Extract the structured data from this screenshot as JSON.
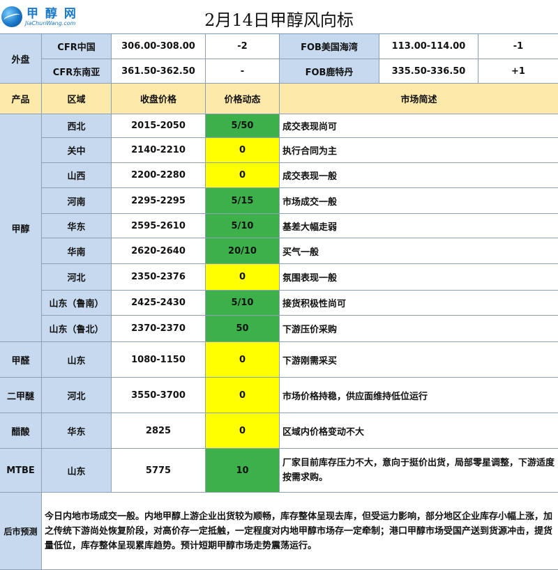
{
  "logo": {
    "cn": "甲 醇 网",
    "en": "JiaChunWang.com"
  },
  "title": "2月14日甲醇风向标",
  "external": {
    "label": "外盘",
    "rows": [
      {
        "name1": "CFR中国",
        "price1": "306.00-308.00",
        "chg1": "-2",
        "name2": "FOB美国海湾",
        "price2": "113.00-114.00",
        "chg2": "-1"
      },
      {
        "name1": "CFR东南亚",
        "price1": "361.50-362.50",
        "chg1": "-",
        "name2": "FOB鹿特丹",
        "price2": "335.50-336.50",
        "chg2": "+1"
      }
    ]
  },
  "headers": {
    "product": "产品",
    "region": "区域",
    "price": "收盘价格",
    "change": "价格动态",
    "desc": "市场简述"
  },
  "methanol": {
    "label": "甲醇",
    "rows": [
      {
        "region": "西北",
        "price": "2015-2050",
        "change": "5/50",
        "desc": "成交表现尚可",
        "color": "#3cb14a"
      },
      {
        "region": "关中",
        "price": "2140-2210",
        "change": "0",
        "desc": "执行合同为主",
        "color": "#ffff00"
      },
      {
        "region": "山西",
        "price": "2200-2280",
        "change": "0",
        "desc": "成交表现一般",
        "color": "#ffff00"
      },
      {
        "region": "河南",
        "price": "2295-2295",
        "change": "5/15",
        "desc": "市场成交一般",
        "color": "#3cb14a"
      },
      {
        "region": "华东",
        "price": "2595-2610",
        "change": "5/10",
        "desc": "基差大幅走弱",
        "color": "#3cb14a"
      },
      {
        "region": "华南",
        "price": "2620-2640",
        "change": "20/10",
        "desc": "买气一般",
        "color": "#3cb14a"
      },
      {
        "region": "河北",
        "price": "2350-2376",
        "change": "0",
        "desc": "氛围表现一般",
        "color": "#ffff00"
      },
      {
        "region": "山东（鲁南）",
        "price": "2425-2430",
        "change": "5/10",
        "desc": "接货积极性尚可",
        "color": "#3cb14a"
      },
      {
        "region": "山东（鲁北）",
        "price": "2370-2370",
        "change": "50",
        "desc": "下游压价采购",
        "color": "#3cb14a"
      }
    ]
  },
  "others": [
    {
      "product": "甲醛",
      "region": "山东",
      "price": "1080-1150",
      "change": "0",
      "desc": "下游刚需采买",
      "color": "#ffff00"
    },
    {
      "product": "二甲醚",
      "region": "河北",
      "price": "3550-3700",
      "change": "0",
      "desc": "市场价格持稳，供应面维持低位运行",
      "color": "#ffff00"
    },
    {
      "product": "醋酸",
      "region": "华东",
      "price": "2825",
      "change": "0",
      "desc": "区域内价格变动不大",
      "color": "#ffff00"
    },
    {
      "product": "MTBE",
      "region": "山东",
      "price": "5775",
      "change": "10",
      "desc": "厂家目前库存压力不大，意向于挺价出货，局部零星调整，下游适度按需求购。",
      "color": "#3cb14a"
    }
  ],
  "forecast": {
    "label": "后市预测",
    "text": "今日内地市场成交一般。内地甲醇上游企业出货较为顺畅，库存整体呈现去库，但受运力影响，部分地区企业库存小幅上涨，加之传统下游尚处恢复阶段，对高价存一定抵触，一定程度对内地甲醇市场存一定牵制；港口甲醇市场受国产送到货源冲击，提货量低位，库存整体呈现累库趋势。预计短期甲醇市场走势震荡运行。"
  }
}
